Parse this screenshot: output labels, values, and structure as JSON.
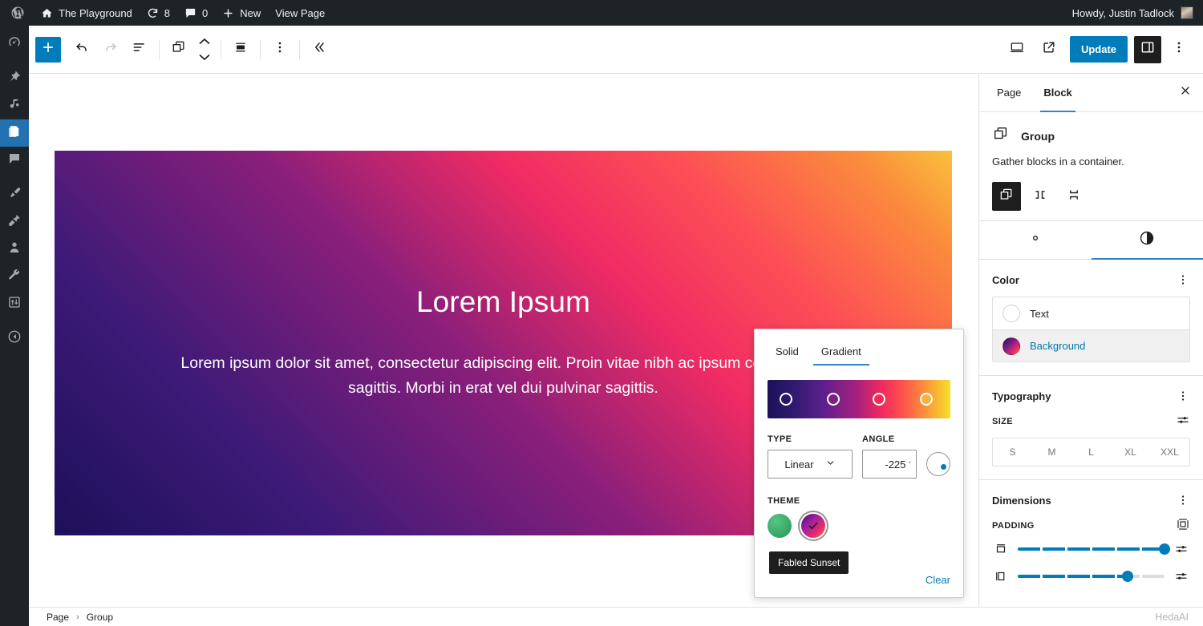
{
  "admin_bar": {
    "logo_icon": "wordpress-icon",
    "site_icon": "home-icon",
    "site_name": "The Playground",
    "revisions_icon": "update-icon",
    "revisions_count": "8",
    "comments_icon": "comment-icon",
    "comments_count": "0",
    "new_icon": "plus-icon",
    "new_label": "New",
    "view_page_label": "View Page",
    "account_greeting": "Howdy, Justin Tadlock",
    "avatar_icon": "avatar"
  },
  "admin_menu": {
    "items": [
      {
        "name": "dashboard",
        "icon": "dashboard-icon",
        "current": false
      },
      {
        "name": "posts",
        "icon": "pin-icon",
        "current": false
      },
      {
        "name": "media",
        "icon": "media-icon",
        "current": false
      },
      {
        "name": "pages",
        "icon": "pages-icon",
        "current": true
      },
      {
        "name": "comments",
        "icon": "comment-icon",
        "current": false
      },
      {
        "name": "appearance",
        "icon": "paintbrush-icon",
        "current": false
      },
      {
        "name": "plugins",
        "icon": "plugin-icon",
        "current": false
      },
      {
        "name": "users",
        "icon": "users-icon",
        "current": false
      },
      {
        "name": "tools",
        "icon": "wrench-icon",
        "current": false
      },
      {
        "name": "settings",
        "icon": "settings-icon",
        "current": false
      },
      {
        "name": "collapse-menu",
        "icon": "collapse-icon",
        "current": false
      }
    ]
  },
  "editor_toolbar": {
    "add_block_icon": "plus-icon",
    "undo_icon": "undo-icon",
    "redo_icon": "redo-icon",
    "list_view_icon": "list-view-icon",
    "block_type_icon": "group-block-icon",
    "move_up_icon": "chevron-up-icon",
    "move_down_icon": "chevron-down-icon",
    "align_icon": "align-icon",
    "more_options_icon": "ellipsis-vertical-icon",
    "collapse_icon": "chevron-double-left-icon",
    "view_icon": "desktop-icon",
    "preview_icon": "external-link-icon",
    "update_label": "Update",
    "settings_toggle_icon": "sidebar-panel-icon",
    "options_icon": "ellipsis-vertical-icon"
  },
  "canvas": {
    "title": "Lorem Ipsum",
    "paragraph": "Lorem ipsum dolor sit amet, consectetur adipiscing elit. Proin vitae nibh ac ipsum consectetur sagittis. Morbi in erat vel dui pulvinar sagittis.",
    "background_gradient": "linear-gradient(45deg, #1d1059 0%, #3d1a78 22%, #8a1f7a 46%, #f02b64 64%, #fd4f55 78%, #fb8b3c 92%, #f9c13c 100%)"
  },
  "footer": {
    "breadcrumb": [
      "Page",
      "Group"
    ],
    "separator": "›",
    "watermark": "HedaAI"
  },
  "sidebar": {
    "tabs": [
      {
        "label": "Page",
        "active": false
      },
      {
        "label": "Block",
        "active": true
      }
    ],
    "close_icon": "close-icon",
    "block": {
      "icon": "group-block-icon",
      "title": "Group",
      "description": "Gather blocks in a container.",
      "variations": [
        {
          "name": "group",
          "icon": "group-block-icon",
          "selected": true
        },
        {
          "name": "row",
          "icon": "row-block-icon",
          "selected": false
        },
        {
          "name": "stack",
          "icon": "stack-block-icon",
          "selected": false
        }
      ]
    },
    "panel_tabs": [
      {
        "name": "settings",
        "icon": "gear-icon",
        "active": false
      },
      {
        "name": "styles",
        "icon": "contrast-icon",
        "active": true
      }
    ],
    "color": {
      "title": "Color",
      "kebab_icon": "ellipsis-vertical-icon",
      "rows": [
        {
          "label": "Text",
          "swatch": "#ffffff",
          "selected": false
        },
        {
          "label": "Background",
          "swatch": "gradient",
          "selected": true
        }
      ]
    },
    "typography": {
      "title": "Typography",
      "kebab_icon": "ellipsis-vertical-icon",
      "size_label": "SIZE",
      "size_tool_icon": "sliders-icon",
      "sizes": [
        "S",
        "M",
        "L",
        "XL",
        "XXL"
      ]
    },
    "dimensions": {
      "title": "Dimensions",
      "kebab_icon": "ellipsis-vertical-icon",
      "padding_label": "PADDING",
      "padding_tool_icon": "sides-icon",
      "sliders": [
        {
          "name": "padding-vertical",
          "icon": "vertical-padding-icon",
          "value": 100,
          "tool_icon": "sliders-icon"
        },
        {
          "name": "padding-horizontal",
          "icon": "horizontal-padding-icon",
          "value": 75,
          "tool_icon": "sliders-icon"
        }
      ]
    }
  },
  "gradient_popover": {
    "tabs": [
      {
        "label": "Solid",
        "active": false
      },
      {
        "label": "Gradient",
        "active": true
      }
    ],
    "gradient_css": "linear-gradient(90deg, #1d1059 0%, #2f1a6e 14%, #5b1f8c 30%, #a3207e 48%, #f0295f 62%, #fb4a4f 72%, #fb8b3c 85%, #f5e02a 100%)",
    "stops": [
      {
        "position": 10,
        "color": "#2a1566"
      },
      {
        "position": 36,
        "color": "#7b1f86"
      },
      {
        "position": 61,
        "color": "#f52a5c"
      },
      {
        "position": 87,
        "color": "#f9b33a"
      }
    ],
    "type_label": "TYPE",
    "type_value": "Linear",
    "type_chevron_icon": "chevron-down-icon",
    "angle_label": "ANGLE",
    "angle_value": "-225",
    "angle_unit": "°",
    "angle_dial_icon": "angle-dial",
    "theme_label": "THEME",
    "theme_swatches": [
      {
        "name": "green-thumb",
        "css": "radial-gradient(circle at 35% 30%, #57c785 0%, #35a463 70%, #2c8f55 100%)",
        "selected": false
      },
      {
        "name": "fabled-sunset",
        "css": "linear-gradient(135deg, #4b1066 0%, #9b1fa0 35%, #e62a6e 70%, #fb7040 100%)",
        "selected": true
      }
    ],
    "tooltip": "Fabled Sunset",
    "clear_label": "Clear",
    "check_icon": "check-icon"
  }
}
